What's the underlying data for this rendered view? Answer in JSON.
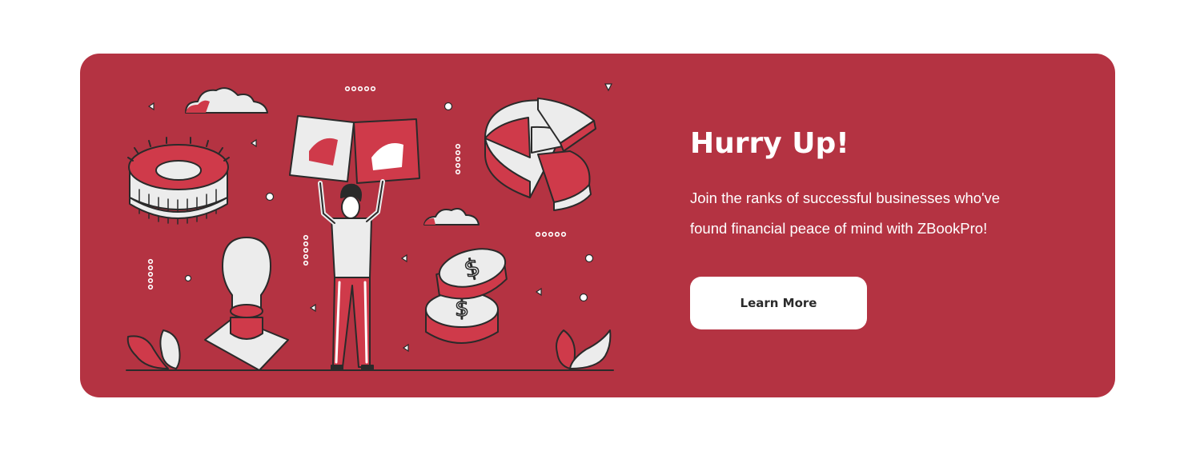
{
  "banner": {
    "title": "Hurry Up!",
    "description": "Join the ranks of successful businesses who've found financial peace of mind with ZBookPro!",
    "cta_label": "Learn More"
  },
  "colors": {
    "page_background": "#ffffff",
    "banner_background": "#b43342",
    "accent_red": "#cf3a4a",
    "illustration_light": "#ececec",
    "outline": "#2a2a2a",
    "button_text": "#2b2b2b"
  },
  "illustration": {
    "icons": [
      "cloud-icon",
      "gear-icon",
      "lightbulb-icon",
      "pie-chart-icon",
      "dollar-coin-icon",
      "plant-icon",
      "person-holding-boxes-icon",
      "logo-box-icon"
    ]
  }
}
